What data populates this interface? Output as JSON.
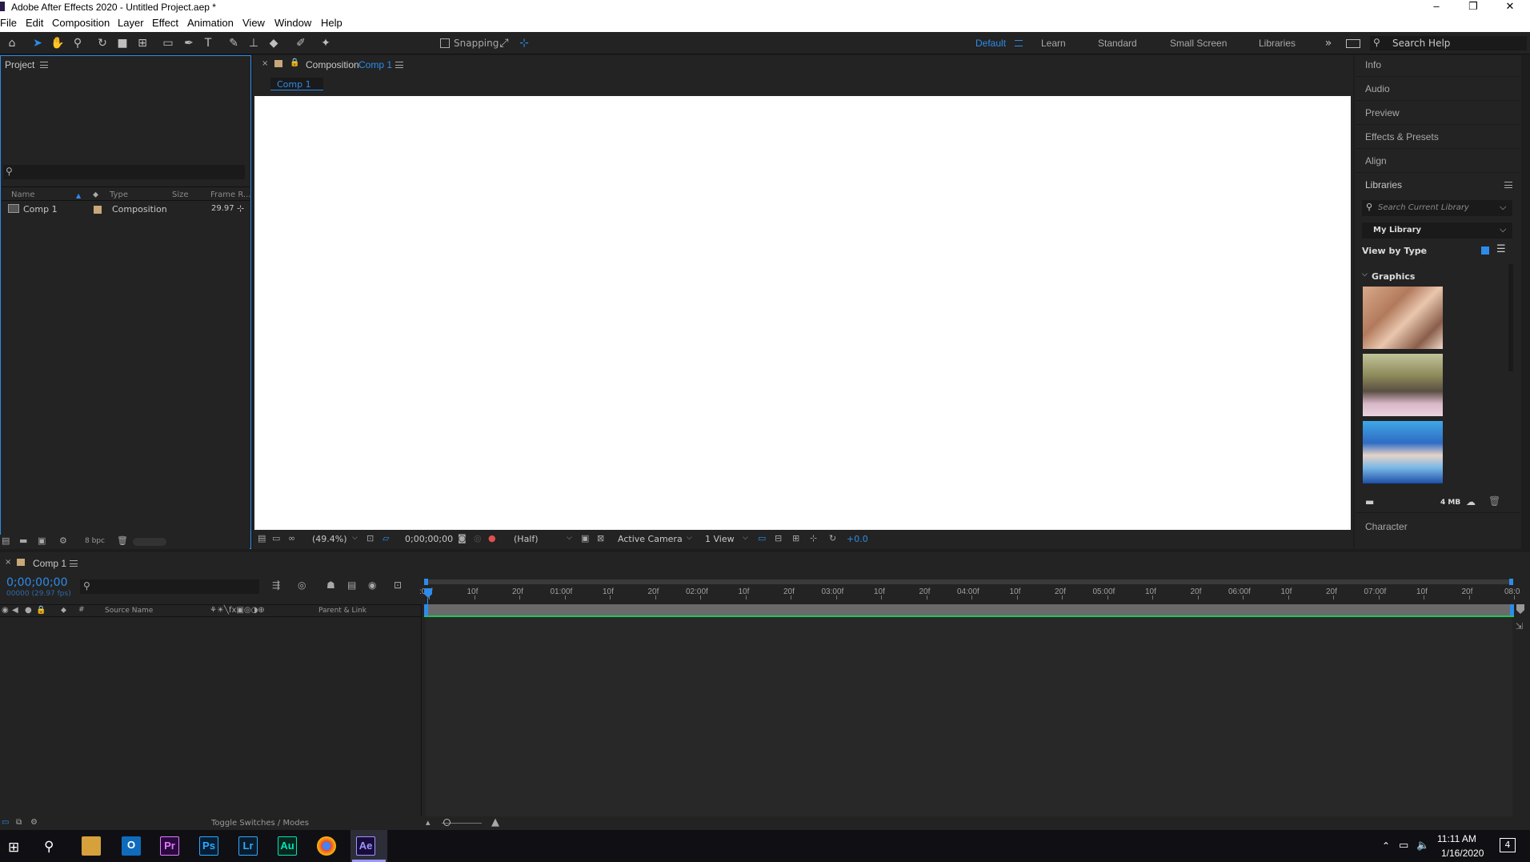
{
  "window": {
    "title": "Adobe After Effects 2020 - Untitled Project.aep *",
    "controls": [
      "–",
      "❐",
      "✕"
    ]
  },
  "menu": [
    "File",
    "Edit",
    "Composition",
    "Layer",
    "Effect",
    "Animation",
    "View",
    "Window",
    "Help"
  ],
  "toolbar": {
    "snapping_label": "Snapping",
    "workspaces": [
      "Default",
      "Learn",
      "Standard",
      "Small Screen",
      "Libraries"
    ],
    "active_workspace": "Default",
    "search_help_placeholder": "Search Help"
  },
  "project_panel": {
    "title": "Project",
    "columns": [
      "Name",
      "Type",
      "Size",
      "Frame R..."
    ],
    "items": [
      {
        "name": "Comp 1",
        "type": "Composition",
        "size": "",
        "frame_rate": "29.97"
      }
    ],
    "bit_depth": "8 bpc"
  },
  "composition_panel": {
    "title_prefix": "Composition",
    "comp_name": "Comp 1",
    "tab": "Comp 1",
    "zoom": "(49.4%)",
    "timecode": "0;00;00;00",
    "resolution": "(Half)",
    "camera": "Active Camera",
    "views": "1 View",
    "exposure": "+0.0"
  },
  "right_panel": {
    "items": [
      "Info",
      "Audio",
      "Preview",
      "Effects & Presets",
      "Align"
    ],
    "libraries": {
      "title": "Libraries",
      "search_placeholder": "Search Current Library",
      "library_name": "My Library",
      "view_by": "View by Type",
      "section": "Graphics",
      "storage": "4 MB"
    },
    "character": "Character"
  },
  "timeline": {
    "comp_tab": "Comp 1",
    "timecode": "0;00;00;00",
    "frames_fps": "00000 (29.97 fps)",
    "columns": [
      "#",
      "Source Name",
      "Parent & Link"
    ],
    "ruler_labels": [
      ":00f",
      "10f",
      "20f",
      "01:00f",
      "10f",
      "20f",
      "02:00f",
      "10f",
      "20f",
      "03:00f",
      "10f",
      "20f",
      "04:00f",
      "10f",
      "20f",
      "05:00f",
      "10f",
      "20f",
      "06:00f",
      "10f",
      "20f",
      "07:00f",
      "10f",
      "20f",
      "08:0"
    ],
    "toggle_label": "Toggle Switches / Modes"
  },
  "taskbar": {
    "apps": [
      "Pr",
      "Ps",
      "Lr",
      "Au",
      "Ae"
    ],
    "time": "11:11 AM",
    "date": "1/16/2020",
    "notifications": "4"
  },
  "colors": {
    "accent": "#2d8ceb",
    "panel_bg": "#232323",
    "app_bg": "#1d1d1d",
    "comp_label": "#c8a878",
    "work_area": "#22c55e"
  }
}
